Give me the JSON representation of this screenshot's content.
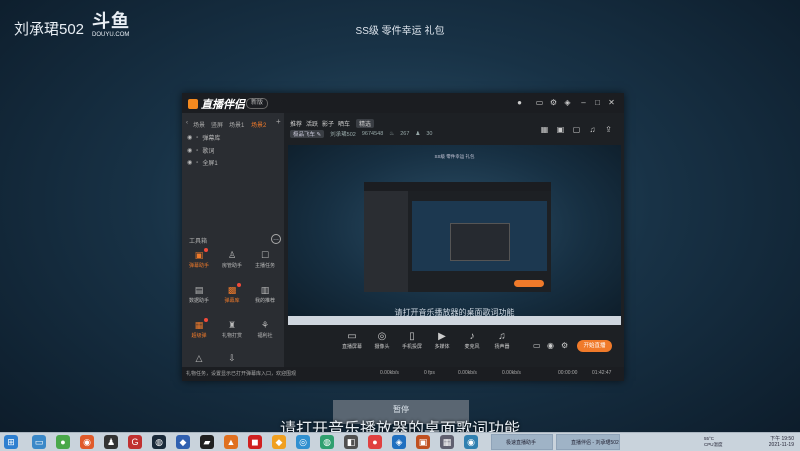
{
  "overlay": {
    "streamer": "刘承珺502",
    "brand": "斗鱼",
    "brand_url": "DOUYU.COM",
    "top_caption": "SS级 零件幸运 礼包",
    "subtitle": "请打开音乐播放器的桌面歌词功能",
    "bottom_button": "暂停"
  },
  "app": {
    "name": "直播伴侣",
    "version_badge": "新版",
    "scene_tabs": [
      "场景",
      "竖屏",
      "场景1",
      "场景2"
    ],
    "sources": [
      "弹幕库",
      "歌词",
      "全屏1"
    ],
    "tools_title": "工具箱",
    "tools": [
      {
        "label": "弹幕助手",
        "icon": "chat-icon",
        "highlight": true
      },
      {
        "label": "房管助手",
        "icon": "user-icon",
        "highlight": false
      },
      {
        "label": "主播任务",
        "icon": "task-icon",
        "highlight": false
      },
      {
        "label": "数据助手",
        "icon": "data-icon",
        "highlight": false
      },
      {
        "label": "弹幕库",
        "icon": "library-icon",
        "highlight": true
      },
      {
        "label": "我的推荐",
        "icon": "recommend-icon",
        "highlight": false
      },
      {
        "label": "超级弹",
        "icon": "super-icon",
        "highlight": true
      },
      {
        "label": "礼物打赏",
        "icon": "gift-icon",
        "highlight": false
      },
      {
        "label": "福利社",
        "icon": "welfare-icon",
        "highlight": false
      },
      {
        "label": "",
        "icon": "more-icon",
        "highlight": false
      },
      {
        "label": "",
        "icon": "download-icon",
        "highlight": false
      }
    ],
    "nav_tabs": [
      "推荐",
      "活跃",
      "影子",
      "晒车",
      "精选"
    ],
    "active_nav": "精选",
    "room_chip": "极品飞车",
    "stream_meta": [
      "刘承珺502",
      "9674548",
      "267",
      "30"
    ],
    "preview_caption": "SS级 零件幸运 礼包",
    "preview_subtitle": "请打开音乐播放器的桌面歌词功能",
    "bottom_tools": [
      {
        "label": "直播屏幕",
        "icon": "screen-icon"
      },
      {
        "label": "摄像头",
        "icon": "camera-icon"
      },
      {
        "label": "手机投屏",
        "icon": "phone-icon"
      },
      {
        "label": "多媒体",
        "icon": "media-icon"
      },
      {
        "label": "麦克风",
        "icon": "mic-icon"
      },
      {
        "label": "扬声器",
        "icon": "speaker-icon"
      }
    ],
    "start_button": "开始直播",
    "status_msg": "礼物任务，设置显示已打开弹幕库入口，欢迎围观",
    "stats": [
      "0.00kb/s",
      "0 fps",
      "0.00kb/s",
      "0.00kb/s",
      "00:00:00",
      "01:42:47"
    ]
  },
  "taskbar": {
    "apps": [
      "极速直播助手",
      "直播伴侣 - 刘承珺502"
    ],
    "tray": [
      "55°C",
      "CPU温度"
    ],
    "time": "下午 19:50",
    "date": "2021-11-19"
  }
}
